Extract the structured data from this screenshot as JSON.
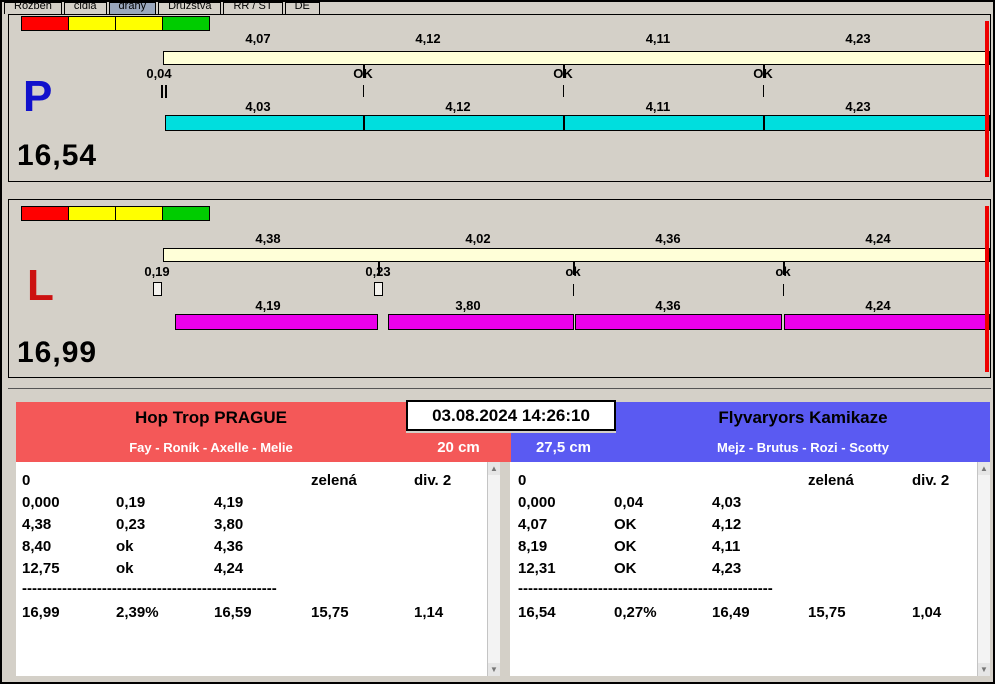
{
  "tabs": [
    "Rozběh",
    "čidla",
    "dráhy",
    "Družstva",
    "RR / ST",
    "DE"
  ],
  "lane_p": {
    "label": "P",
    "total": "16,54",
    "splits_top": [
      "4,07",
      "4,12",
      "4,11",
      "4,23"
    ],
    "marks": [
      "0,04",
      "OK",
      "OK",
      "OK"
    ],
    "splits_bottom": [
      "4,03",
      "4,12",
      "4,11",
      "4,23"
    ]
  },
  "lane_l": {
    "label": "L",
    "total": "16,99",
    "splits_top": [
      "4,38",
      "4,02",
      "4,36",
      "4,24"
    ],
    "marks": [
      "0,19",
      "0,23",
      "ok",
      "ok"
    ],
    "splits_bottom": [
      "4,19",
      "3,80",
      "4,36",
      "4,24"
    ]
  },
  "scoreboard": {
    "timestamp": "03.08.2024 14:26:10",
    "left": {
      "team": "Hop Trop PRAGUE",
      "members": "Fay - Roník - Axelle - Melie",
      "height": "20 cm"
    },
    "right": {
      "team": "Flyvaryors Kamikaze",
      "members": "Mejz - Brutus - Rozi - Scotty",
      "height": "27,5 cm"
    },
    "left_table": {
      "header": [
        "0",
        "",
        "",
        "zelená",
        "div. 2"
      ],
      "rows": [
        [
          "0,000",
          "0,19",
          "4,19"
        ],
        [
          "4,38",
          "0,23",
          "3,80"
        ],
        [
          "8,40",
          "ok",
          "4,36"
        ],
        [
          "12,75",
          "ok",
          "4,24"
        ]
      ],
      "separator": "---------------------------------------------------",
      "totals": [
        "16,99",
        "2,39%",
        "16,59",
        "15,75",
        "1,14"
      ]
    },
    "right_table": {
      "header": [
        "0",
        "",
        "",
        "zelená",
        "div. 2"
      ],
      "rows": [
        [
          "0,000",
          "0,04",
          "4,03"
        ],
        [
          "4,07",
          "OK",
          "4,12"
        ],
        [
          "8,19",
          "OK",
          "4,11"
        ],
        [
          "12,31",
          "OK",
          "4,23"
        ]
      ],
      "separator": "---------------------------------------------------",
      "totals": [
        "16,54",
        "0,27%",
        "16,49",
        "15,75",
        "1,04"
      ]
    }
  },
  "colors": {
    "light_red": "#ff0000",
    "light_yellow": "#ffff00",
    "light_green": "#00cc00",
    "bar_cream": "#ffffd8",
    "bar_cyan": "#00dede",
    "bar_magenta": "#ea00ea",
    "team_left_bg": "#f45858",
    "team_right_bg": "#5a5af2",
    "letter_p": "#1111cc",
    "letter_l": "#cc1111",
    "finish_strip": "#ee0000"
  }
}
